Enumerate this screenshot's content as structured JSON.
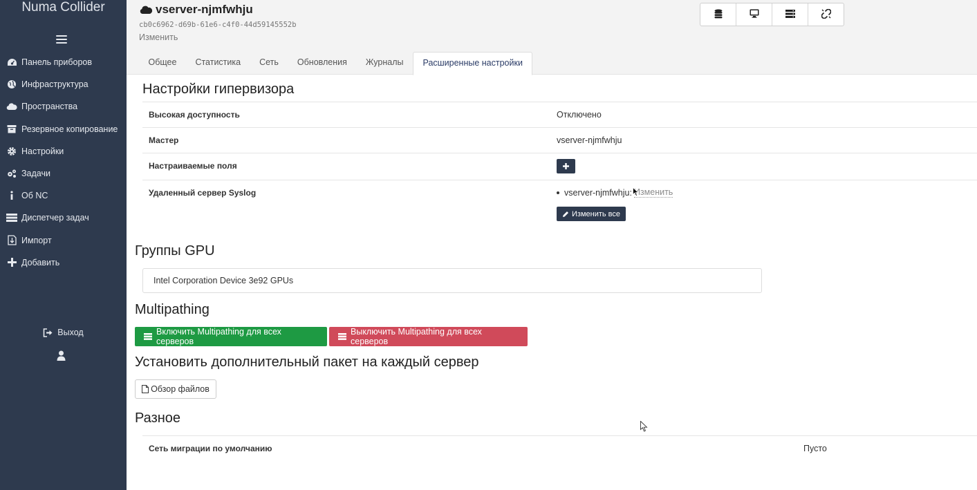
{
  "sidebar": {
    "brand": "Numa Collider",
    "menu_icon": "hamburger-icon",
    "items": [
      {
        "label": "Панель приборов",
        "icon": "dashboard-icon"
      },
      {
        "label": "Инфраструктура",
        "icon": "globe-icon"
      },
      {
        "label": "Пространства",
        "icon": "cloud-icon"
      },
      {
        "label": "Резервное копирование",
        "icon": "archive-icon"
      },
      {
        "label": "Настройки",
        "icon": "gear-icon"
      },
      {
        "label": "Задачи",
        "icon": "gears-icon"
      },
      {
        "label": "Об NC",
        "icon": "info-icon"
      },
      {
        "label": "Диспетчер задач",
        "icon": "task-list-icon"
      },
      {
        "label": "Импорт",
        "icon": "import-file-icon"
      },
      {
        "label": "Добавить",
        "icon": "plus-icon"
      }
    ],
    "logout_label": "Выход",
    "user_icon": "user-icon"
  },
  "header": {
    "title": "vserver-njmfwhju",
    "uuid": "cb0c6962-d69b-61e6-c4f0-44d59145552b",
    "edit_label": "Изменить",
    "toolbar_icons": [
      "database-icon",
      "monitor-icon",
      "server-list-icon",
      "unlink-icon"
    ],
    "tabs": [
      {
        "label": "Общее"
      },
      {
        "label": "Статистика"
      },
      {
        "label": "Сеть"
      },
      {
        "label": "Обновления"
      },
      {
        "label": "Журналы"
      },
      {
        "label": "Расширенные настройки"
      }
    ],
    "active_tab": "Расширенные настройки"
  },
  "hypervisor": {
    "heading": "Настройки гипервизора",
    "high_availability_label": "Высокая доступность",
    "high_availability_value": "Отключено",
    "master_label": "Мастер",
    "master_value": "vserver-njmfwhju",
    "custom_fields_label": "Настраиваемые поля",
    "syslog_label": "Удаленный сервер Syslog",
    "syslog_host": "vserver-njmfwhju:",
    "syslog_edit": "Изменить",
    "edit_all_label": "Изменить все"
  },
  "gpu": {
    "heading": "Группы GPU",
    "group": "Intel Corporation Device 3e92 GPUs"
  },
  "multipathing": {
    "heading": "Multipathing",
    "enable_label": "Включить Multipathing для всех серверов",
    "disable_label": "Выключить Multipathing для всех серверов"
  },
  "package": {
    "heading": "Установить дополнительный пакет на каждый сервер",
    "browse_label": "Обзор файлов"
  },
  "misc": {
    "heading": "Разное",
    "migration_network_label": "Сеть миграции по умолчанию",
    "migration_network_value": "Пусто"
  },
  "colors": {
    "sidebar_bg": "#2e3a4e",
    "green": "#1e9a43",
    "red": "#d04a5a"
  }
}
